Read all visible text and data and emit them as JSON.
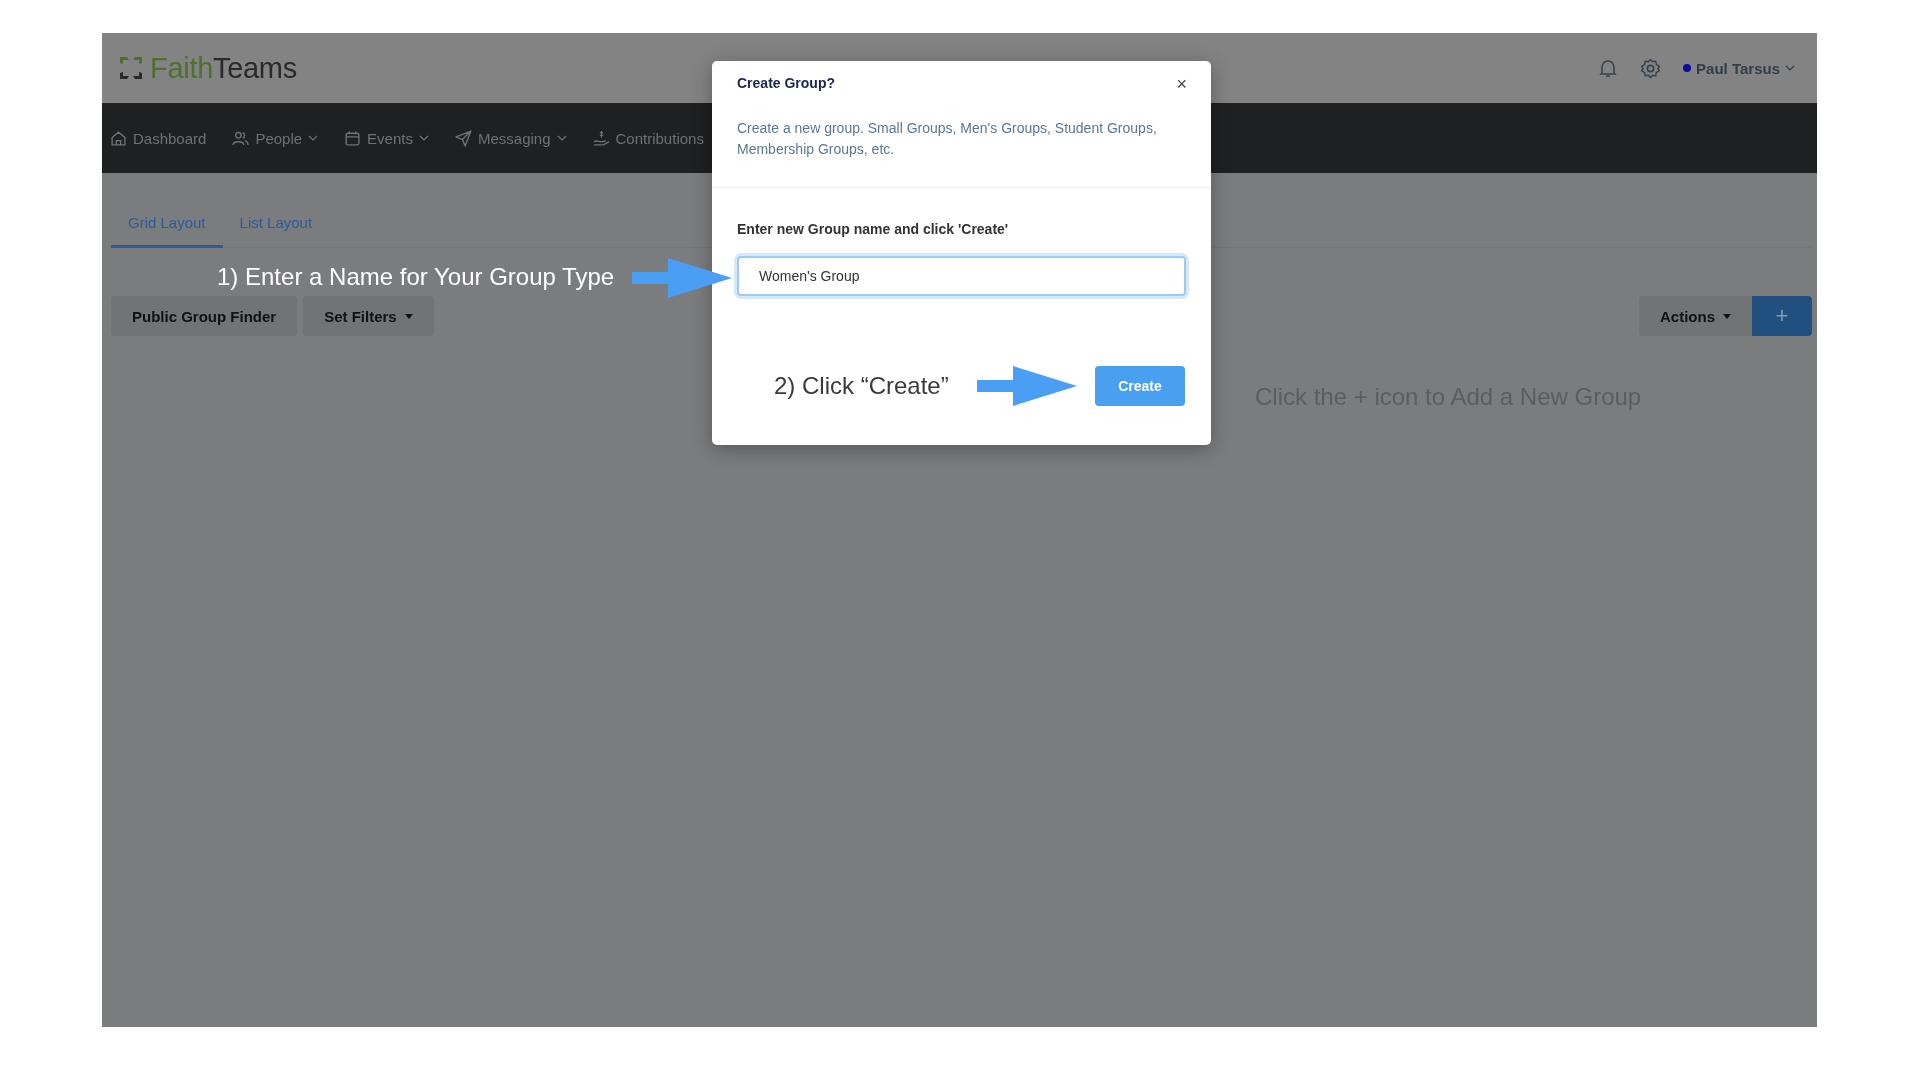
{
  "header": {
    "logo_words": [
      "Faith",
      "Teams"
    ],
    "user_name": "Paul Tarsus"
  },
  "nav": [
    {
      "kind": "home",
      "label": "Dashboard",
      "has_dropdown": false
    },
    {
      "kind": "people",
      "label": "People",
      "has_dropdown": true
    },
    {
      "kind": "calendar",
      "label": "Events",
      "has_dropdown": true
    },
    {
      "kind": "send",
      "label": "Messaging",
      "has_dropdown": true
    },
    {
      "kind": "giving",
      "label": "Contributions",
      "has_dropdown": false
    }
  ],
  "tabs": [
    {
      "label": "Grid Layout",
      "selected": true
    },
    {
      "label": "List Layout",
      "selected": false
    }
  ],
  "toolbar": {
    "left_buttons": [
      {
        "label": "Public Group Finder",
        "has_dropdown": false
      },
      {
        "label": "Set Filters",
        "has_dropdown": true
      }
    ],
    "actions_button": "Actions",
    "add_button": "+"
  },
  "empty_message": "Click the + icon to Add a New Group",
  "dialog": {
    "title": "Create Group?",
    "close": "×",
    "description": "Create a new group. Small Groups, Men's Groups, Student Groups, Membership Groups, etc.",
    "field_label": "Enter new Group name and click 'Create'",
    "field_value": "Women's Group",
    "submit": "Create"
  },
  "annotations": [
    {
      "text": "1) Enter a Name for Your Group Type",
      "kind": "light"
    },
    {
      "text": "2) Click “Create”",
      "kind": "dark"
    }
  ]
}
